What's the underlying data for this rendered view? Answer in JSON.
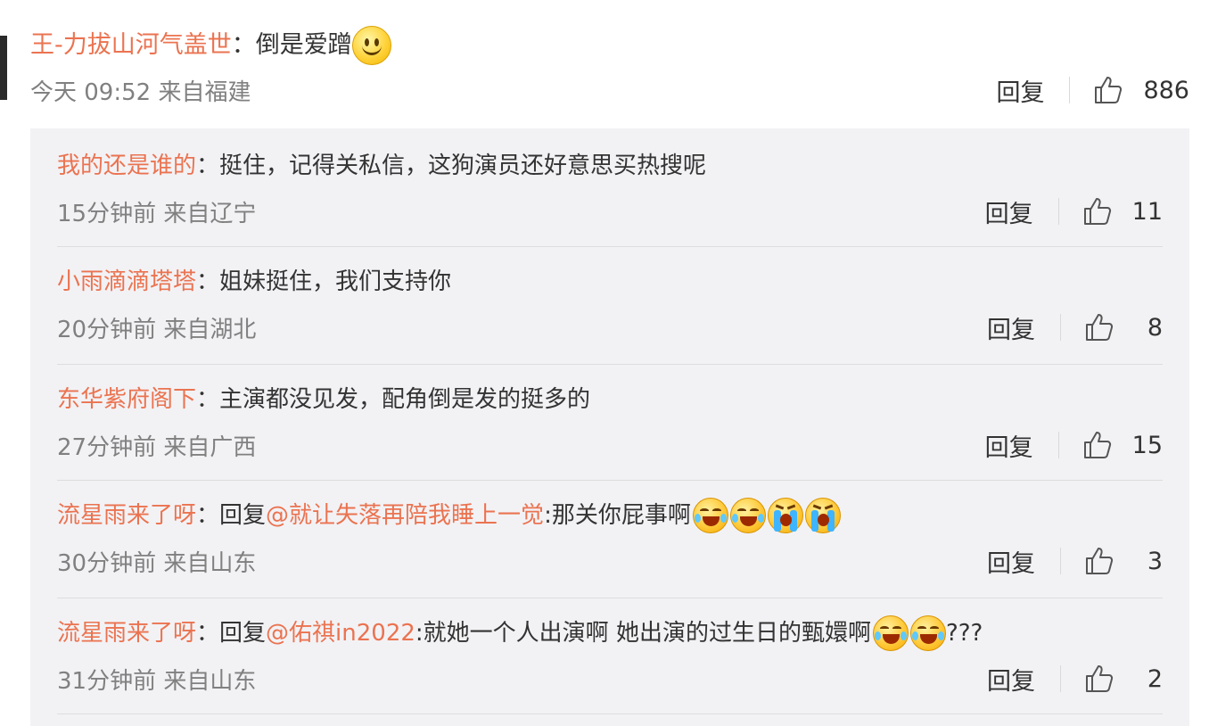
{
  "main_comment": {
    "username": "王-力拔山河气盖世",
    "colon": "：",
    "text": "倒是爱蹭",
    "emoji": "smile-emoji",
    "time": "今天 09:52 来自福建",
    "reply_label": "回复",
    "likes": "886"
  },
  "replies": [
    {
      "username": "我的还是谁的",
      "colon": "：",
      "text": "挺住，记得关私信，这狗演员还好意思买热搜呢",
      "time": "15分钟前 来自辽宁",
      "reply_label": "回复",
      "likes": "11"
    },
    {
      "username": "小雨滴滴塔塔",
      "colon": "：",
      "text": "姐妹挺住，我们支持你",
      "time": "20分钟前 来自湖北",
      "reply_label": "回复",
      "likes": "8"
    },
    {
      "username": "东华紫府阁下",
      "colon": "：",
      "text": "主演都没见发，配角倒是发的挺多的",
      "time": "27分钟前 来自广西",
      "reply_label": "回复",
      "likes": "15"
    },
    {
      "username": "流星雨来了呀",
      "colon": "：",
      "prefix": "回复",
      "mention": "@就让失落再陪我睡上一觉",
      "text": ":那关你屁事啊",
      "emojis": [
        "laugh-emoji",
        "laugh-emoji",
        "cry-emoji",
        "cry-emoji"
      ],
      "time": "30分钟前 来自山东",
      "reply_label": "回复",
      "likes": "3"
    },
    {
      "username": "流星雨来了呀",
      "colon": "：",
      "prefix": "回复",
      "mention": "@佑祺in2022",
      "text": ":就她一个人出演啊 她出演的过生日的甄嬛啊",
      "emojis": [
        "laugh-emoji",
        "laugh-emoji"
      ],
      "suffix": "???",
      "time": "31分钟前 来自山东",
      "reply_label": "回复",
      "likes": "2"
    }
  ],
  "colors": {
    "username": "#eb7350",
    "text": "#333333",
    "meta": "#808080",
    "reply_background": "#f2f2f5"
  }
}
